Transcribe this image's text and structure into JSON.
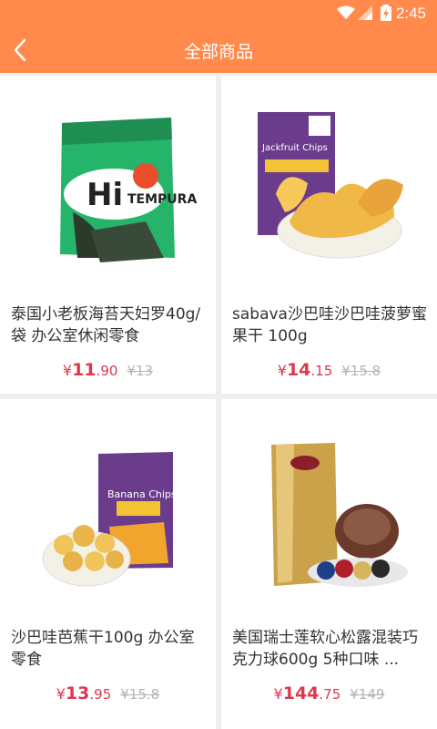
{
  "status_bar": {
    "time": "2:45",
    "icons": [
      "wifi-icon",
      "signal-icon",
      "battery-charging-icon"
    ]
  },
  "header": {
    "title": "全部商品",
    "back_icon": "chevron-left-icon"
  },
  "colors": {
    "accent": "#ff8a4c",
    "price": "#e0374b",
    "old_price": "#b4b4b4"
  },
  "products": [
    {
      "name": "泰国小老板海苔天妇罗40g/袋 办公室休闲零食",
      "currency": "¥",
      "price_int": "11",
      "price_dec": ".90",
      "old_price": "¥13",
      "image": "seaweed-snack-image"
    },
    {
      "name": "sabava沙巴哇沙巴哇菠萝蜜果干 100g",
      "currency": "¥",
      "price_int": "14",
      "price_dec": ".15",
      "old_price": "¥15.8",
      "image": "jackfruit-chips-image"
    },
    {
      "name": "沙巴哇芭蕉干100g 办公室零食",
      "currency": "¥",
      "price_int": "13",
      "price_dec": ".95",
      "old_price": "¥15.8",
      "image": "banana-chips-image"
    },
    {
      "name": "美国瑞士莲软心松露混装巧克力球600g 5种口味 ...",
      "currency": "¥",
      "price_int": "144",
      "price_dec": ".75",
      "old_price": "¥149",
      "image": "lindt-chocolate-image"
    }
  ]
}
